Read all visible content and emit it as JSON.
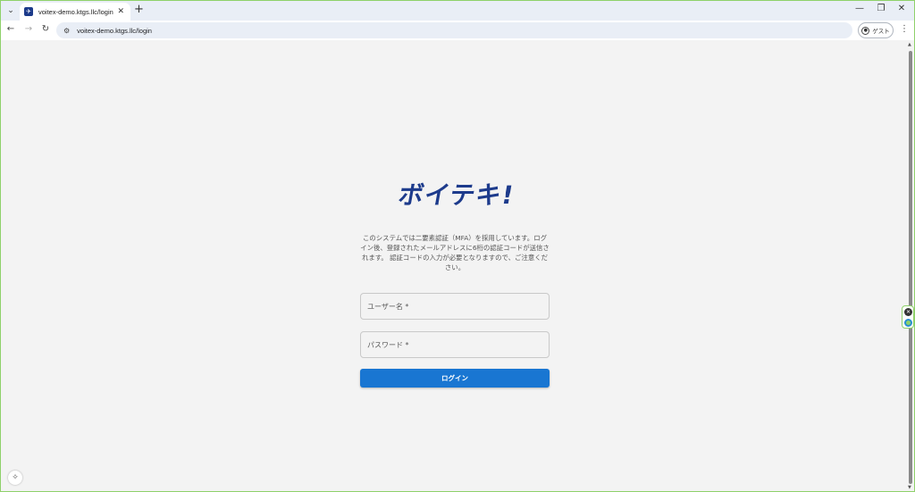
{
  "browser": {
    "tab_title": "voitex-demo.ktgs.llc/login",
    "url": "voitex-demo.ktgs.llc/login",
    "profile_label": "ゲスト"
  },
  "login": {
    "logo_text": "ボイテキ!",
    "notice": "このシステムでは二要素認証（MFA）を採用しています。ログイン後、登録されたメールアドレスに6桁の認証コードが送信されます。 認証コードの入力が必要となりますので、ご注意ください。",
    "username_label": "ユーザー名 *",
    "password_label": "パスワード *",
    "login_button": "ログイン"
  },
  "colors": {
    "logo": "#1d3b8c",
    "primary_button": "#1976d2"
  }
}
